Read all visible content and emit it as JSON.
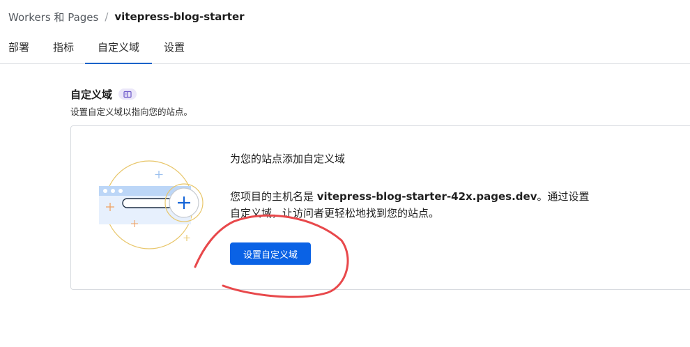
{
  "breadcrumb": {
    "parent": "Workers 和 Pages",
    "separator": "/",
    "current": "vitepress-blog-starter"
  },
  "tabs": [
    {
      "label": "部署",
      "active": false
    },
    {
      "label": "指标",
      "active": false
    },
    {
      "label": "自定义域",
      "active": true
    },
    {
      "label": "设置",
      "active": false
    }
  ],
  "section": {
    "title": "自定义域",
    "badge_icon": "book-icon",
    "subtitle": "设置自定义域以指向您的站点。"
  },
  "card": {
    "heading": "为您的站点添加自定义域",
    "desc_prefix": "您项目的主机名是 ",
    "hostname": "vitepress-blog-starter-42x.pages.dev",
    "desc_suffix": "。通过设置自定义域，让访问者更轻松地找到您的站点。",
    "button_label": "设置自定义域"
  },
  "colors": {
    "accent": "#0a62e5",
    "tab_underline": "#1a63c9",
    "annotation": "#e8484b",
    "illustration_ring": "#e8b93a"
  }
}
